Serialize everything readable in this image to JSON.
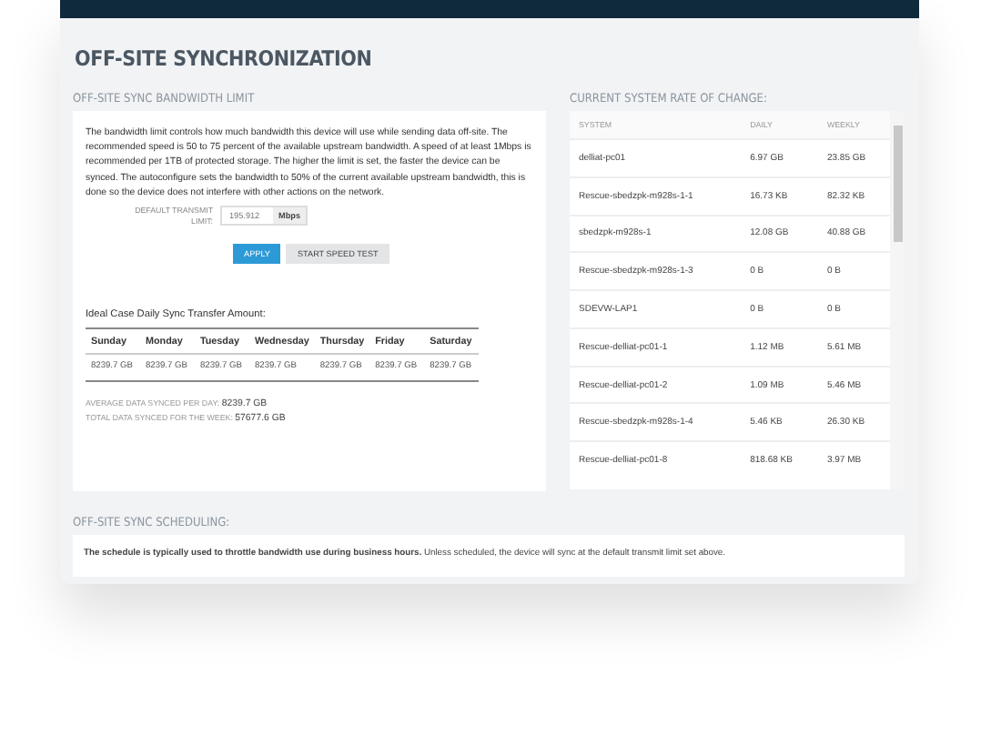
{
  "page_title": "OFF-SITE SYNCHRONIZATION",
  "bandwidth": {
    "heading": "OFF-SITE SYNC BANDWIDTH LIMIT",
    "description": "The bandwidth limit controls how much bandwidth this device will use while sending data off-site. The recommended speed is 50 to 75 percent of the available upstream bandwidth. A speed of at least 1Mbps is recommended per 1TB of protected storage. The higher the limit is set, the faster the device can be synced. The autoconfigure sets the bandwidth to 50% of the current available upstream bandwidth, this is done so the device does not interfere with other actions on the network.",
    "field_label": "DEFAULT TRANSMIT LIMIT:",
    "field_value": "195.912",
    "field_unit": "Mbps",
    "buttons": [
      {
        "label": "APPLY",
        "kind": "primary"
      },
      {
        "label": "START SPEED TEST",
        "kind": "secondary"
      }
    ],
    "daily_title": "Ideal Case Daily Sync Transfer Amount:",
    "days": [
      {
        "day": "Sunday",
        "amount": "8239.7 GB"
      },
      {
        "day": "Monday",
        "amount": "8239.7 GB"
      },
      {
        "day": "Tuesday",
        "amount": "8239.7 GB"
      },
      {
        "day": "Wednesday",
        "amount": "8239.7 GB"
      },
      {
        "day": "Thursday",
        "amount": "8239.7 GB"
      },
      {
        "day": "Friday",
        "amount": "8239.7 GB"
      },
      {
        "day": "Saturday",
        "amount": "8239.7 GB"
      }
    ],
    "summary": [
      {
        "label": "AVERAGE DATA SYNCED PER DAY:",
        "value": "8239.7 GB"
      },
      {
        "label": "TOTAL DATA SYNCED FOR THE WEEK:",
        "value": "57677.6 GB"
      }
    ]
  },
  "rate_of_change": {
    "heading": "CURRENT SYSTEM RATE OF CHANGE:",
    "columns": [
      "SYSTEM",
      "DAILY",
      "WEEKLY"
    ],
    "rows": [
      [
        "delliat-pc01",
        "6.97 GB",
        "23.85 GB"
      ],
      [
        "Rescue-sbedzpk-m928s-1-1",
        "16.73 KB",
        "82.32 KB"
      ],
      [
        "sbedzpk-m928s-1",
        "12.08 GB",
        "40.88 GB"
      ],
      [
        "Rescue-sbedzpk-m928s-1-3",
        "0 B",
        "0 B"
      ],
      [
        "SDEVW-LAP1",
        "0 B",
        "0 B"
      ],
      [
        "Rescue-delliat-pc01-1",
        "1.12 MB",
        "5.61 MB"
      ],
      [
        "Rescue-delliat-pc01-2",
        "1.09 MB",
        "5.46 MB"
      ],
      [
        "Rescue-sbedzpk-m928s-1-4",
        "5.46 KB",
        "26.30 KB"
      ],
      [
        "Rescue-delliat-pc01-8",
        "818.68 KB",
        "3.97 MB"
      ]
    ]
  },
  "scheduling": {
    "heading": "OFF-SITE SYNC SCHEDULING:",
    "text": "**The schedule is typically used to throttle bandwidth use during business hours.** Unless scheduled, the device will sync at the default transmit limit set above."
  }
}
